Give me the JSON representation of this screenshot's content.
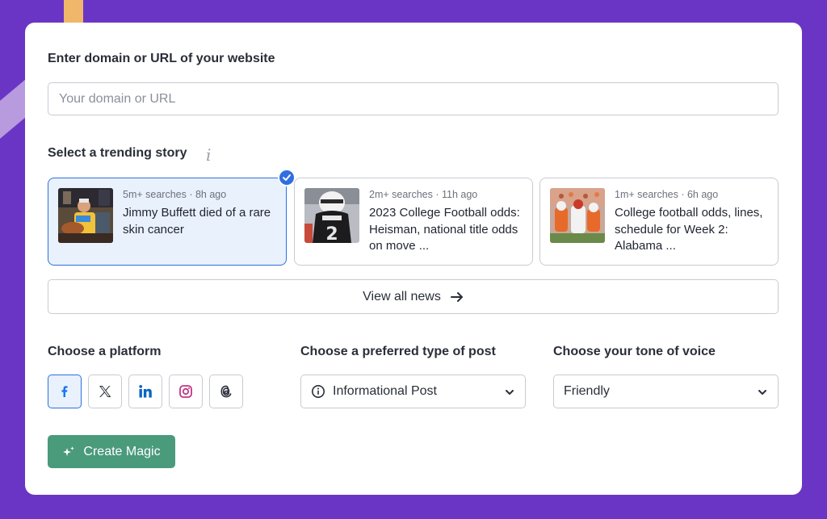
{
  "domain_section": {
    "label": "Enter domain or URL of your website",
    "input_value": "",
    "input_placeholder": "Your domain or URL"
  },
  "story_section": {
    "label": "Select a trending story",
    "stories": [
      {
        "meta": "5m+ searches · 8h ago",
        "title": "Jimmy Buffett died of a rare skin cancer",
        "selected": true
      },
      {
        "meta": "2m+ searches · 11h ago",
        "title": "2023 College Football odds: Heisman, national title odds on move ...",
        "selected": false
      },
      {
        "meta": "1m+ searches · 6h ago",
        "title": "College football odds, lines, schedule for Week 2: Alabama ...",
        "selected": false
      }
    ],
    "view_all_label": "View all news",
    "view_all_icon": "arrow-right-icon"
  },
  "platform_section": {
    "label": "Choose a platform",
    "platforms": [
      {
        "name": "facebook",
        "icon": "facebook-icon",
        "selected": true
      },
      {
        "name": "x",
        "icon": "x-icon",
        "selected": false
      },
      {
        "name": "linkedin",
        "icon": "linkedin-icon",
        "selected": false
      },
      {
        "name": "instagram",
        "icon": "instagram-icon",
        "selected": false
      },
      {
        "name": "threads",
        "icon": "threads-icon",
        "selected": false
      }
    ]
  },
  "post_type_section": {
    "label": "Choose a preferred type of post",
    "selected": "Informational Post",
    "icon": "info-circle-icon"
  },
  "tone_section": {
    "label": "Choose your tone of voice",
    "selected": "Friendly"
  },
  "create_button": {
    "label": "Create Magic",
    "icon": "sparkle-icon"
  },
  "colors": {
    "background": "#6a35c4",
    "accent_blue": "#2f6fe0",
    "create_green": "#4a9a7c",
    "facebook": "#1877f2",
    "linkedin": "#0a66c2",
    "instagram": "#c13584"
  }
}
